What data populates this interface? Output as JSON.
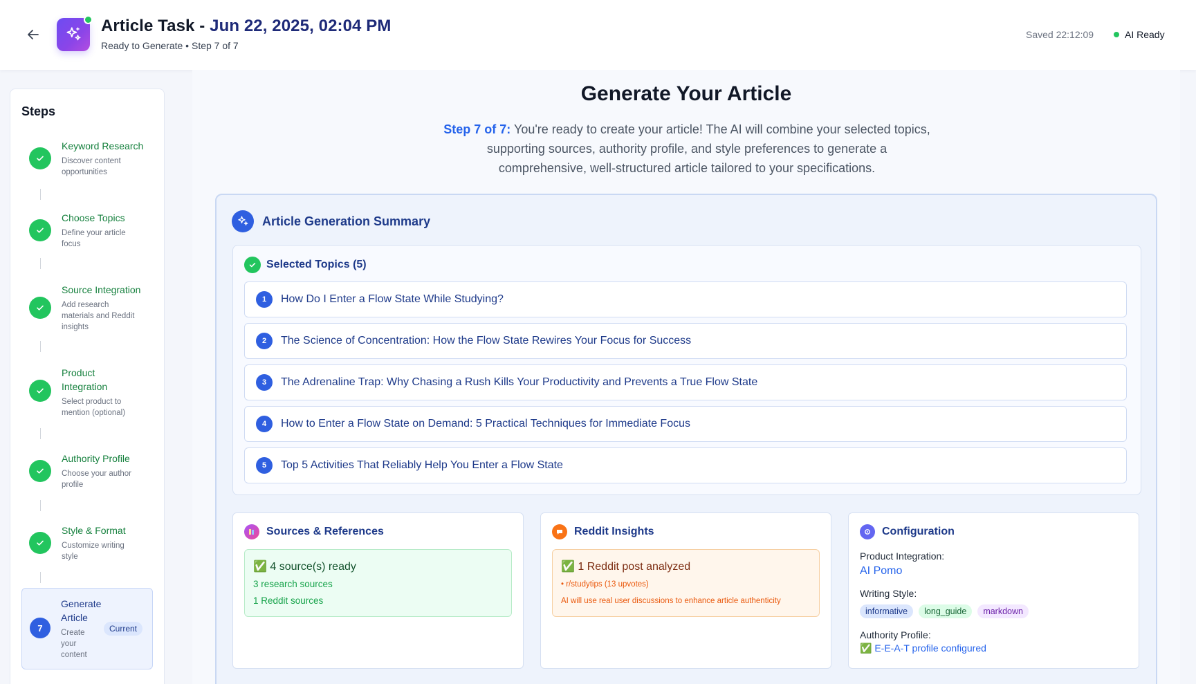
{
  "header": {
    "title_prefix": "Article Task - ",
    "title_date": "Jun 22, 2025, 02:04 PM",
    "subtitle": "Ready to Generate • Step 7 of 7",
    "saved": "Saved 22:12:09",
    "ai_status": "AI Ready"
  },
  "sidebar": {
    "title": "Steps",
    "steps": [
      {
        "label": "Keyword Research",
        "desc": "Discover content opportunities"
      },
      {
        "label": "Choose Topics",
        "desc": "Define your article focus"
      },
      {
        "label": "Source Integration",
        "desc": "Add research materials and Reddit insights"
      },
      {
        "label": "Product Integration",
        "desc": "Select product to mention (optional)"
      },
      {
        "label": "Authority Profile",
        "desc": "Choose your author profile"
      },
      {
        "label": "Style & Format",
        "desc": "Customize writing style"
      }
    ],
    "current": {
      "number": "7",
      "label": "Generate Article",
      "desc": "Create your content",
      "badge": "Current"
    }
  },
  "main": {
    "title": "Generate Your Article",
    "desc_strong": "Step 7 of 7:",
    "desc": " You're ready to create your article! The AI will combine your selected topics, supporting sources, authority profile, and style preferences to generate a comprehensive, well-structured article tailored to your specifications.",
    "summary": {
      "title": "Article Generation Summary",
      "topics_title": "Selected Topics (5)",
      "topics": [
        {
          "n": "1",
          "text": "How Do I Enter a Flow State While Studying?"
        },
        {
          "n": "2",
          "text": "The Science of Concentration: How the Flow State Rewires Your Focus for Success"
        },
        {
          "n": "3",
          "text": "The Adrenaline Trap: Why Chasing a Rush Kills Your Productivity and Prevents a True Flow State"
        },
        {
          "n": "4",
          "text": "How to Enter a Flow State on Demand: 5 Practical Techniques for Immediate Focus"
        },
        {
          "n": "5",
          "text": "Top 5 Activities That Reliably Help You Enter a Flow State"
        }
      ],
      "sources": {
        "title": "Sources & References",
        "main": "✅ 4 source(s) ready",
        "research": "3 research sources",
        "reddit": "1 Reddit sources"
      },
      "reddit": {
        "title": "Reddit Insights",
        "main": "✅ 1 Reddit post analyzed",
        "post": "• r/studytips (13 upvotes)",
        "note": "AI will use real user discussions to enhance article authenticity"
      },
      "config": {
        "title": "Configuration",
        "product_label": "Product Integration:",
        "product_value": "AI Pomo",
        "style_label": "Writing Style:",
        "chips": [
          "informative",
          "long_guide",
          "markdown"
        ],
        "authority_label": "Authority Profile:",
        "authority_value": "✅ E-E-A-T profile configured"
      }
    }
  }
}
